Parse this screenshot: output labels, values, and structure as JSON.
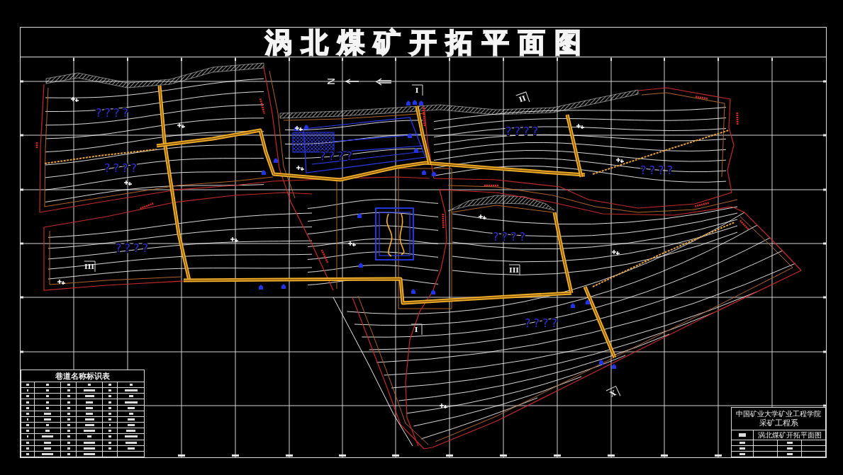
{
  "title": "涡北煤矿开拓平面图",
  "map": {
    "north_label": "N",
    "area_labels": [
      "????",
      "????",
      "????",
      "????",
      "????",
      "????",
      "????",
      "????"
    ],
    "section_markers": [
      "I",
      "II",
      "III",
      "III",
      "I",
      "X"
    ]
  },
  "legend_table": {
    "title": "巷道名称标识表"
  },
  "title_block": {
    "institution": "中国矿业大学矿业工程学院",
    "department": "采矿工程系",
    "drawing_name": "涡北煤矿开拓平面图"
  }
}
